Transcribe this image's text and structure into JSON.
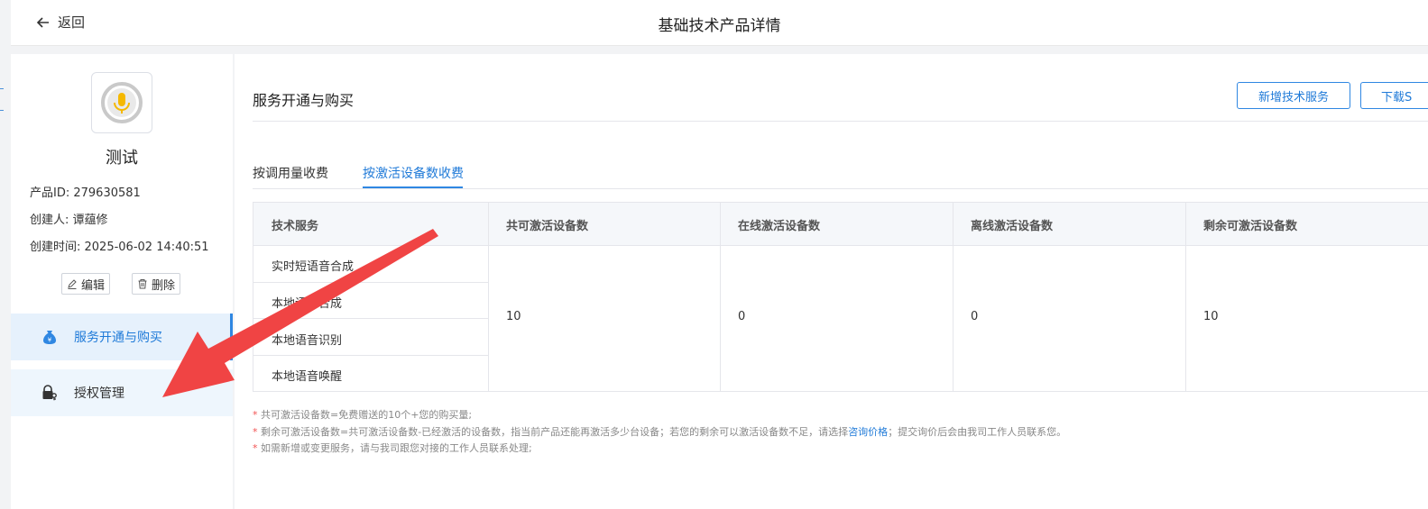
{
  "header": {
    "back_label": "返回",
    "title": "基础技术产品详情"
  },
  "product": {
    "name": "测试",
    "id_line": "产品ID: 279630581",
    "creator_line": "创建人: 谭蕴修",
    "created_line": "创建时间: 2025-06-02 14:40:51",
    "edit_label": "编辑",
    "delete_label": "删除"
  },
  "nav": {
    "items": [
      {
        "label": "服务开通与购买",
        "icon": "money-bag-icon",
        "active": true
      },
      {
        "label": "授权管理",
        "icon": "lock-key-icon",
        "active": false
      }
    ]
  },
  "section": {
    "title": "服务开通与购买",
    "add_button": "新增技术服务",
    "download_button": "下载S"
  },
  "tabs": [
    {
      "label": "按调用量收费",
      "active": false
    },
    {
      "label": "按激活设备数收费",
      "active": true
    }
  ],
  "table": {
    "headers": [
      "技术服务",
      "共可激活设备数",
      "在线激活设备数",
      "离线激活设备数",
      "剩余可激活设备数"
    ],
    "services": [
      "实时短语音合成",
      "本地语音合成",
      "本地语音识别",
      "本地语音唤醒"
    ],
    "values": [
      "10",
      "0",
      "0",
      "10"
    ]
  },
  "notes": {
    "n1": "共可激活设备数=免费赠送的10个+您的购买量;",
    "n2_pre": "剩余可激活设备数=共可激活设备数-已经激活的设备数，指当前产品还能再激活多少台设备；若您的剩余可以激活设备数不足，请选择",
    "n2_link": "咨询价格",
    "n2_post": "；提交询价后会由我司工作人员联系您。",
    "n3": "如需新增或变更服务，请与我司跟您对接的工作人员联系处理;"
  },
  "colors": {
    "accent": "#2f87e2",
    "arrow": "#f04444",
    "mic": "#f5b800"
  }
}
